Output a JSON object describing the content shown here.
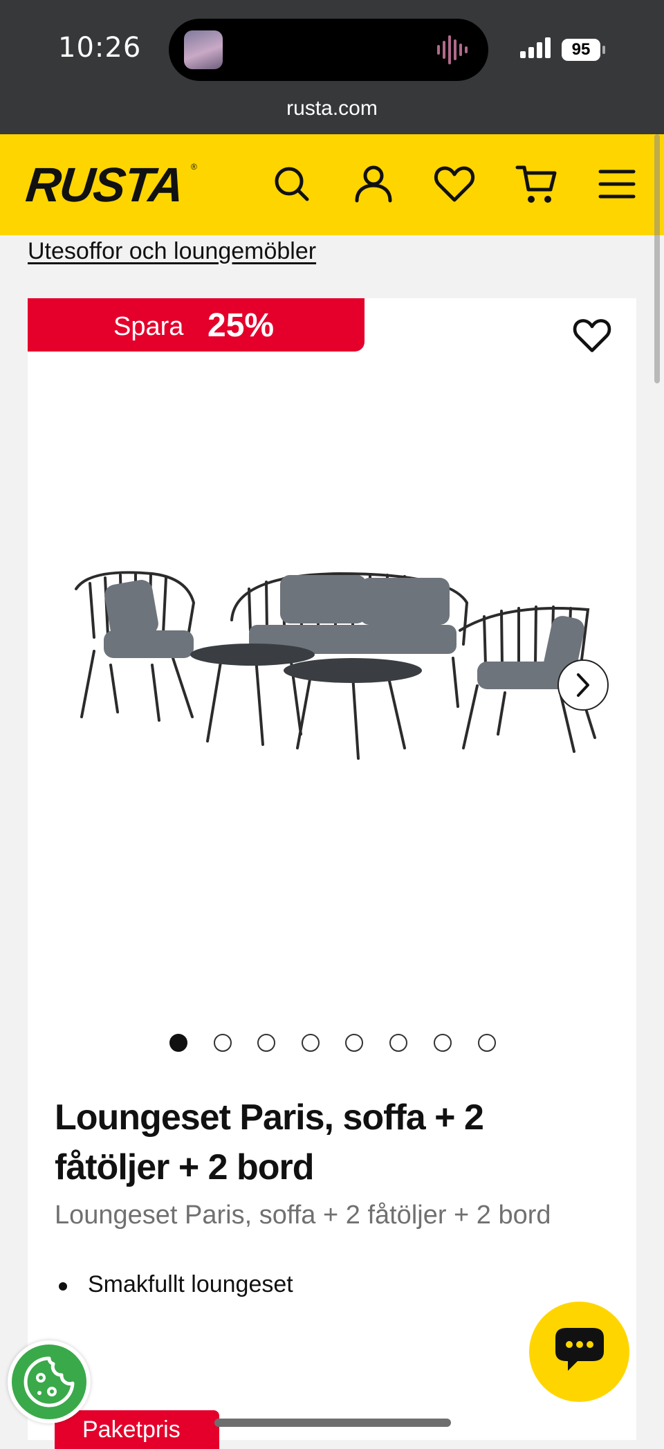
{
  "status_bar": {
    "time": "10:26",
    "battery": "95"
  },
  "browser": {
    "url": "rusta.com"
  },
  "header": {
    "logo": "RUSTA",
    "logo_mark": "®",
    "icons": [
      "search-icon",
      "account-icon",
      "favorites-icon",
      "cart-icon",
      "menu-icon"
    ],
    "brand_color": "#ffd500"
  },
  "breadcrumb": {
    "label": "Utesoffor och loungemöbler"
  },
  "product": {
    "discount": {
      "label": "Spara",
      "value": "25%",
      "color": "#e4002b"
    },
    "image_alt": "Loungeset Paris",
    "gallery": {
      "count": 8,
      "active": 1
    },
    "title": "Loungeset Paris, soffa + 2 fåtöljer + 2 bord",
    "subtitle": "Loungeset Paris, soffa + 2 fåtöljer + 2 bord",
    "bullets": [
      "Smakfullt loungeset"
    ],
    "package_badge": "Paketpris"
  }
}
